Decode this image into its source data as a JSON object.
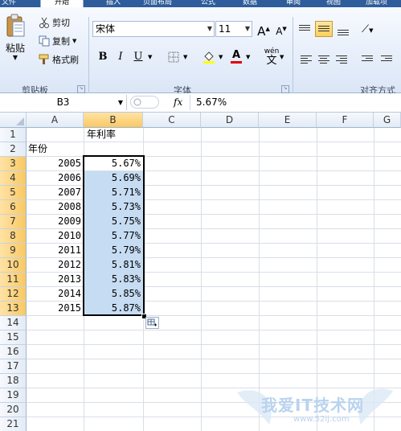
{
  "ribbon": {
    "tabs": [
      "文件",
      "开始",
      "插入",
      "页面布局",
      "公式",
      "数据",
      "审阅",
      "视图",
      "加载项"
    ],
    "clipboard": {
      "paste_label": "粘贴",
      "cut_label": "剪切",
      "copy_label": "复制",
      "format_painter_label": "格式刷",
      "group_label": "剪贴板"
    },
    "font": {
      "font_name": "宋体",
      "font_size": "11",
      "group_label": "字体",
      "bold": "B",
      "italic": "I",
      "underline": "U",
      "grow": "A",
      "shrink": "A",
      "wen": "wén",
      "wen_char": "文"
    },
    "alignment": {
      "group_label": "对齐方式"
    }
  },
  "formula_bar": {
    "name_box": "B3",
    "fx_label": "fx",
    "value": "5.67%"
  },
  "sheet": {
    "columns": [
      "A",
      "B",
      "C",
      "D",
      "E",
      "F",
      "G"
    ],
    "rows": [
      "1",
      "2",
      "3",
      "4",
      "5",
      "6",
      "7",
      "8",
      "9",
      "10",
      "11",
      "12",
      "13",
      "14",
      "15",
      "16",
      "17",
      "18",
      "19",
      "20",
      "21"
    ],
    "b1": "年利率",
    "a2": "年份",
    "data": [
      {
        "year": "2005",
        "rate": "5.67%"
      },
      {
        "year": "2006",
        "rate": "5.69%"
      },
      {
        "year": "2007",
        "rate": "5.71%"
      },
      {
        "year": "2008",
        "rate": "5.73%"
      },
      {
        "year": "2009",
        "rate": "5.75%"
      },
      {
        "year": "2010",
        "rate": "5.77%"
      },
      {
        "year": "2011",
        "rate": "5.79%"
      },
      {
        "year": "2012",
        "rate": "5.81%"
      },
      {
        "year": "2013",
        "rate": "5.83%"
      },
      {
        "year": "2014",
        "rate": "5.85%"
      },
      {
        "year": "2015",
        "rate": "5.87%"
      }
    ]
  },
  "watermark": {
    "text": "我爱IT技术网",
    "url": "www.52ij.com"
  },
  "colors": {
    "ribbon_tab_bg": "#2f5d9b",
    "selection_fill": "#c6dcf3",
    "header_selected": "#f9c864"
  }
}
